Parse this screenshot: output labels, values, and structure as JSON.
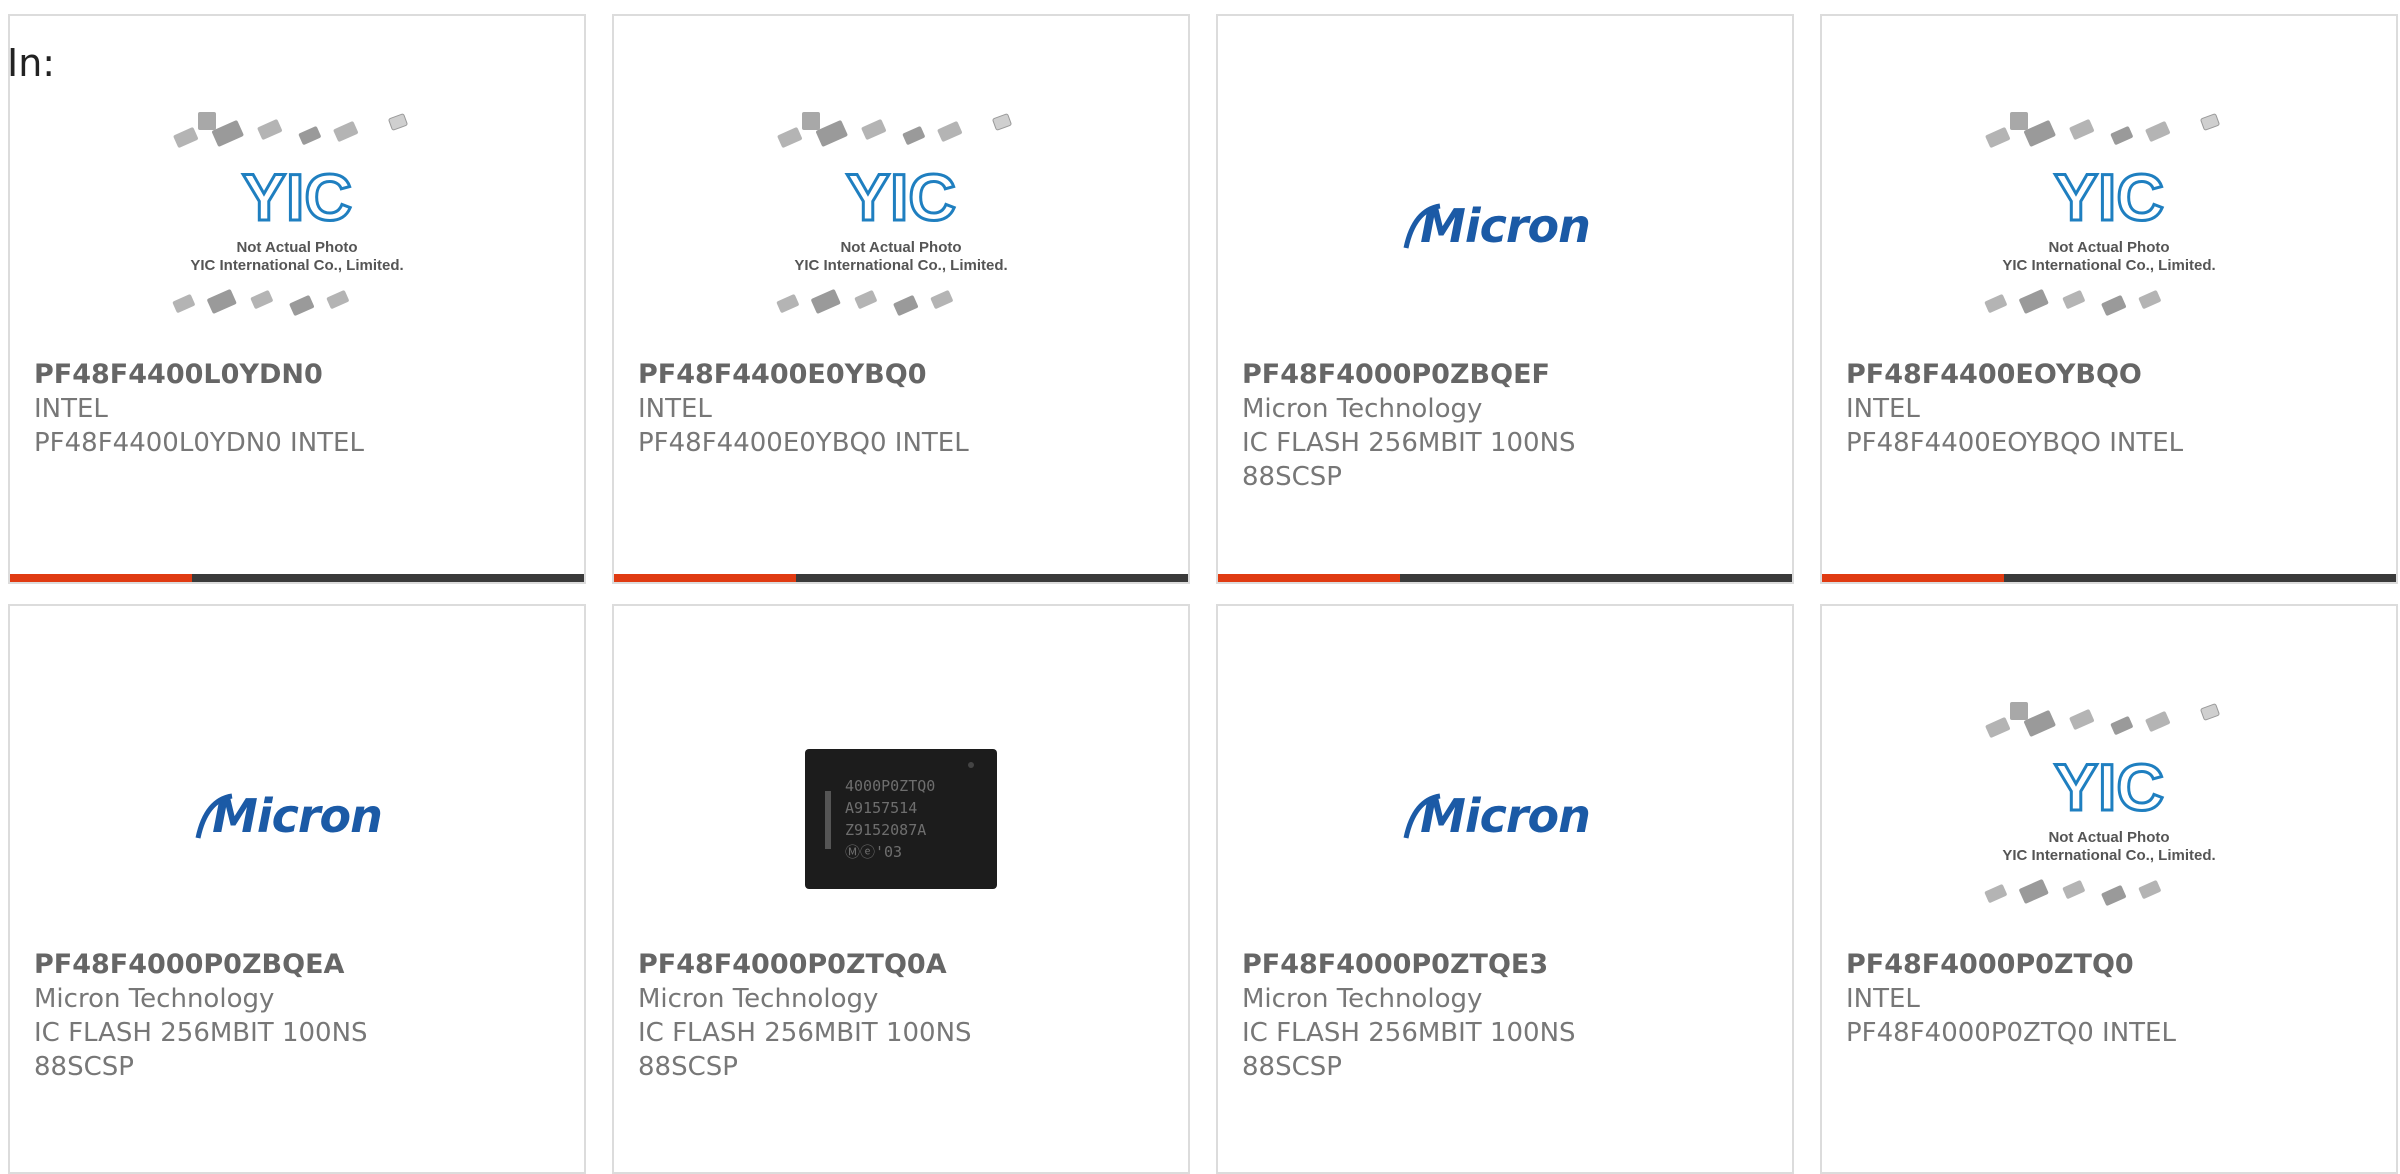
{
  "filter_label": "In:",
  "colors": {
    "accent": "#e03b12",
    "bar": "#3a3a3a",
    "micron_blue": "#1b5aa6",
    "placeholder_blue": "#1f7fc0"
  },
  "placeholder": {
    "line1": "Not Actual Photo",
    "line2": "YIC International Co., Limited.",
    "logo_text": "YIC"
  },
  "micron_logo_text": "Micron",
  "chip_marking": [
    "4000P0ZTQ0",
    "A9157514",
    "Z9152087A",
    "Ⓜⓔ'03"
  ],
  "products": [
    {
      "part_number": "PF48F4400L0YDN0",
      "manufacturer": "INTEL",
      "description": "PF48F4400L0YDN0 INTEL",
      "image": "placeholder",
      "image_icon": "placeholder-photo-icon"
    },
    {
      "part_number": "PF48F4400E0YBQ0",
      "manufacturer": "INTEL",
      "description": "PF48F4400E0YBQ0 INTEL",
      "image": "placeholder",
      "image_icon": "placeholder-photo-icon"
    },
    {
      "part_number": "PF48F4000P0ZBQEF",
      "manufacturer": "Micron Technology",
      "description": "IC FLASH 256MBIT 100NS\n88SCSP",
      "image": "micron",
      "image_icon": "micron-logo-icon"
    },
    {
      "part_number": "PF48F4400EOYBQO",
      "manufacturer": "INTEL",
      "description": "PF48F4400EOYBQO INTEL",
      "image": "placeholder",
      "image_icon": "placeholder-photo-icon"
    },
    {
      "part_number": "PF48F4000P0ZBQEA",
      "manufacturer": "Micron Technology",
      "description": "IC FLASH 256MBIT 100NS\n88SCSP",
      "image": "micron",
      "image_icon": "micron-logo-icon"
    },
    {
      "part_number": "PF48F4000P0ZTQ0A",
      "manufacturer": "Micron Technology",
      "description": "IC FLASH 256MBIT 100NS\n88SCSP",
      "image": "chip",
      "image_icon": "chip-photo-icon"
    },
    {
      "part_number": "PF48F4000P0ZTQE3",
      "manufacturer": "Micron Technology",
      "description": "IC FLASH 256MBIT 100NS\n88SCSP",
      "image": "micron",
      "image_icon": "micron-logo-icon"
    },
    {
      "part_number": "PF48F4000P0ZTQ0",
      "manufacturer": "INTEL",
      "description": "PF48F4000P0ZTQ0 INTEL",
      "image": "placeholder",
      "image_icon": "placeholder-photo-icon"
    }
  ]
}
